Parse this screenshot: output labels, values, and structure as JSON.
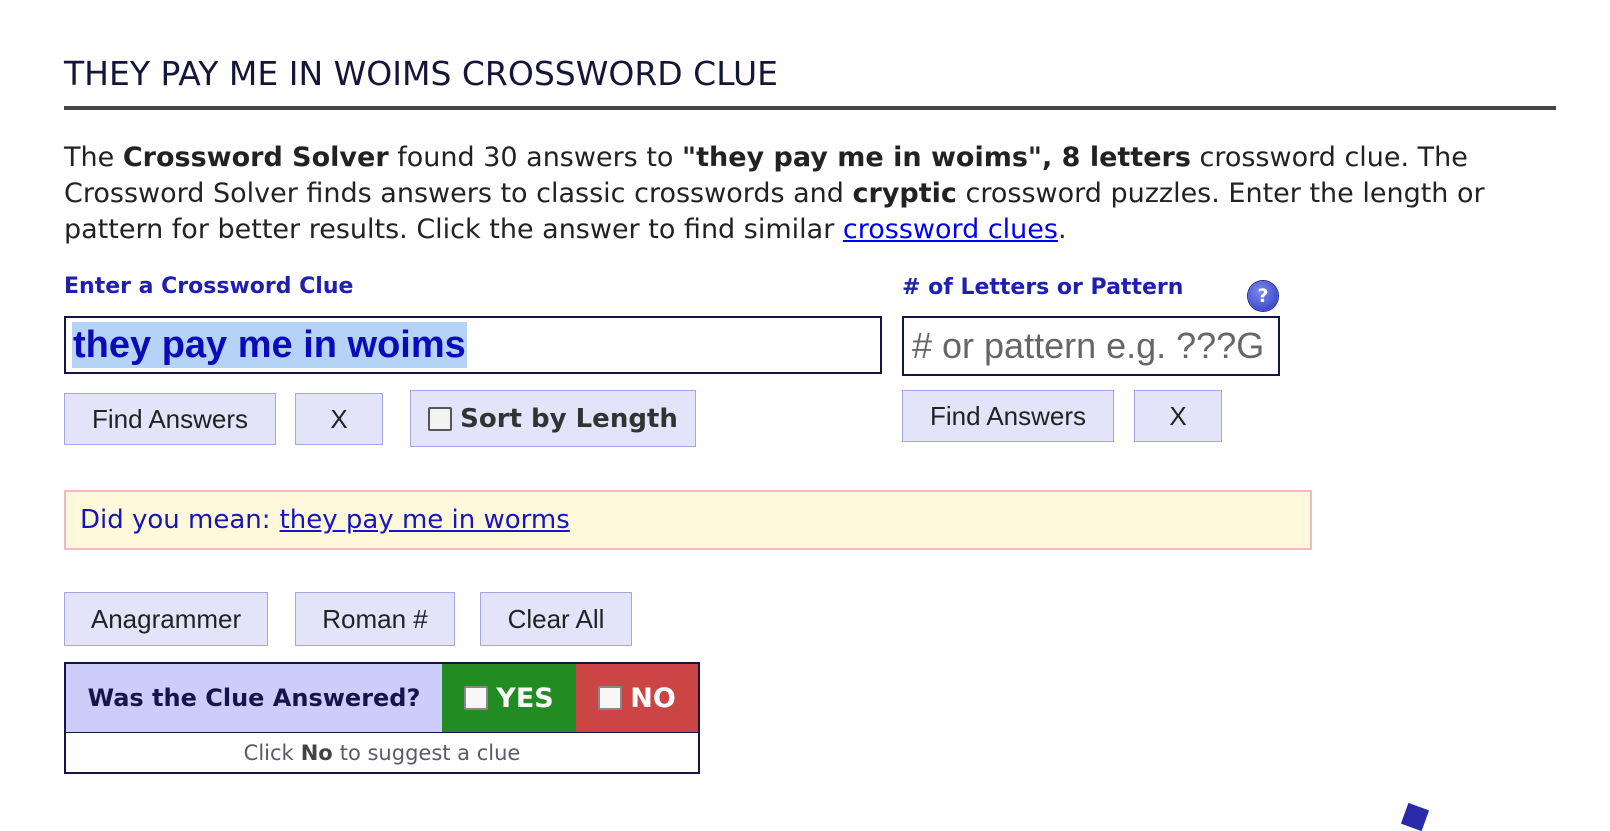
{
  "header": {
    "title": "THEY PAY ME IN WOIMS CROSSWORD CLUE"
  },
  "intro": {
    "part1": "The ",
    "bold1": "Crossword Solver",
    "part2": " found 30 answers to ",
    "bold2": "\"they pay me in woims\", 8 letters",
    "part3": " crossword clue. The Crossword Solver finds answers to classic crosswords and ",
    "bold3": "cryptic",
    "part4": " crossword puzzles. Enter the length or pattern for better results. Click the answer to find similar ",
    "link": "crossword clues",
    "part5": "."
  },
  "clue_form": {
    "label": "Enter a Crossword Clue",
    "value": "they pay me in woims",
    "find_label": "Find Answers",
    "clear_label": "X",
    "sort_label": "Sort by Length",
    "sort_checked": false
  },
  "pattern_form": {
    "label": "# of Letters or Pattern",
    "placeholder": "# or pattern e.g. ???G",
    "help_icon": "question-mark-icon",
    "find_label": "Find Answers",
    "clear_label": "X"
  },
  "suggestion": {
    "prefix": "Did you mean:",
    "link": "they pay me in worms"
  },
  "tools": {
    "anagrammer": "Anagrammer",
    "roman": "Roman #",
    "clear_all": "Clear All"
  },
  "feedback": {
    "question": "Was the Clue Answered?",
    "yes": "YES",
    "no": "NO",
    "hint_pre": "Click",
    "hint_bold": "No",
    "hint_post": "to suggest a clue"
  },
  "colors": {
    "label_blue": "#2020b0",
    "yes_green": "#228b22",
    "no_red": "#cc4545",
    "button_bg": "#e3e3fa",
    "suggest_bg": "#fff8db"
  }
}
